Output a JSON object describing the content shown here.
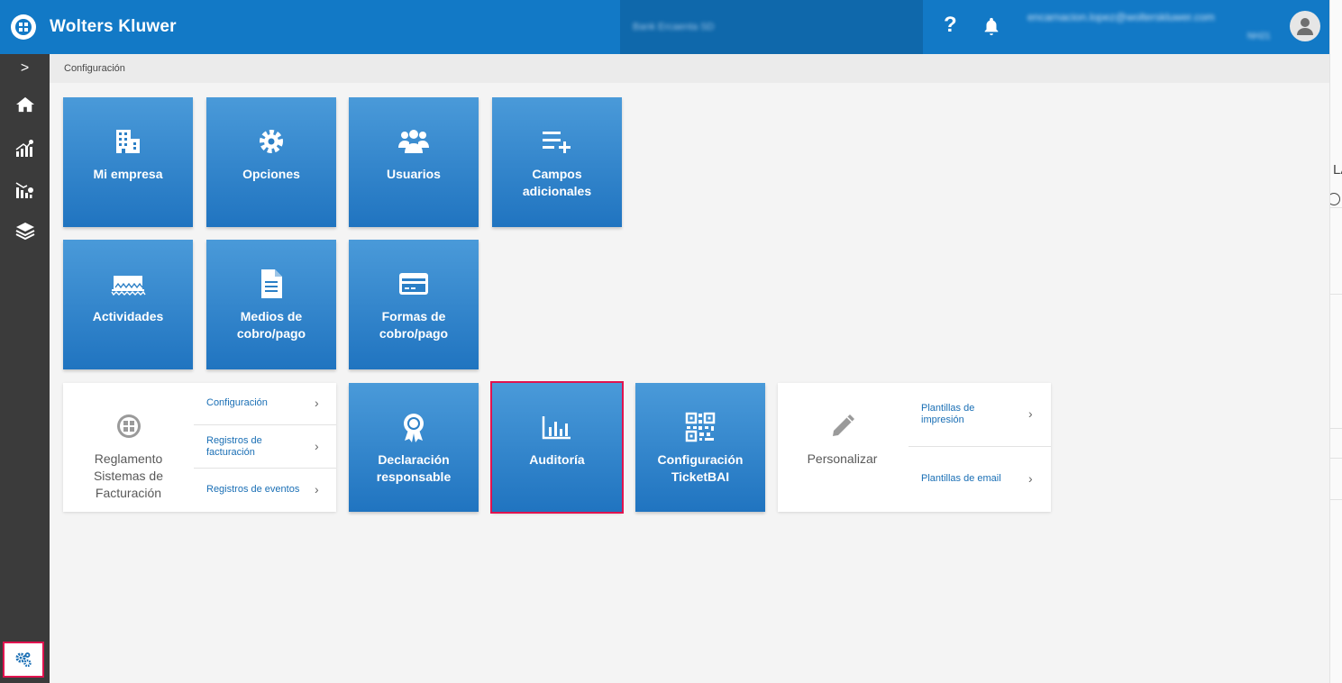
{
  "header": {
    "brand": "Wolters Kluwer",
    "company": "Bank Ercaenta SD",
    "help_label": "?",
    "user_email": "encarnacion.lopez@wolterskluwer.com",
    "user_sub": "NH21"
  },
  "breadcrumb": "Configuración",
  "sidebar": {
    "expand_label": ">",
    "items": [
      "home",
      "dashboard",
      "analytics",
      "layers"
    ],
    "settings": "settings"
  },
  "tiles": {
    "mi_empresa": "Mi empresa",
    "opciones": "Opciones",
    "usuarios": "Usuarios",
    "campos_l1": "Campos",
    "campos_l2": "adicionales",
    "actividades": "Actividades",
    "medios_l1": "Medios de",
    "medios_l2": "cobro/pago",
    "formas_l1": "Formas de",
    "formas_l2": "cobro/pago",
    "declaracion_l1": "Declaración",
    "declaracion_l2": "responsable",
    "auditoria": "Auditoría",
    "ticketbai_l1": "Configuración",
    "ticketbai_l2": "TicketBAI"
  },
  "reglamento": {
    "title_l1": "Reglamento",
    "title_l2": "Sistemas de",
    "title_l3": "Facturación",
    "links": {
      "configuracion": "Configuración",
      "registros_fact_l1": "Registros de",
      "registros_fact_l2": "facturación",
      "registros_eventos": "Registros de eventos"
    }
  },
  "personalizar": {
    "title": "Personalizar",
    "links": {
      "plantillas_impresion_l1": "Plantillas de",
      "plantillas_impresion_l2": "impresión",
      "plantillas_email": "Plantillas de email"
    }
  },
  "edge_text": "LA",
  "colors": {
    "topbar": "#1279c6",
    "sidebar": "#3b3b3b",
    "tile_top": "#4a9ad9",
    "tile_bottom": "#2074c0",
    "highlight": "#e0134f",
    "link": "#1a6fb5"
  }
}
